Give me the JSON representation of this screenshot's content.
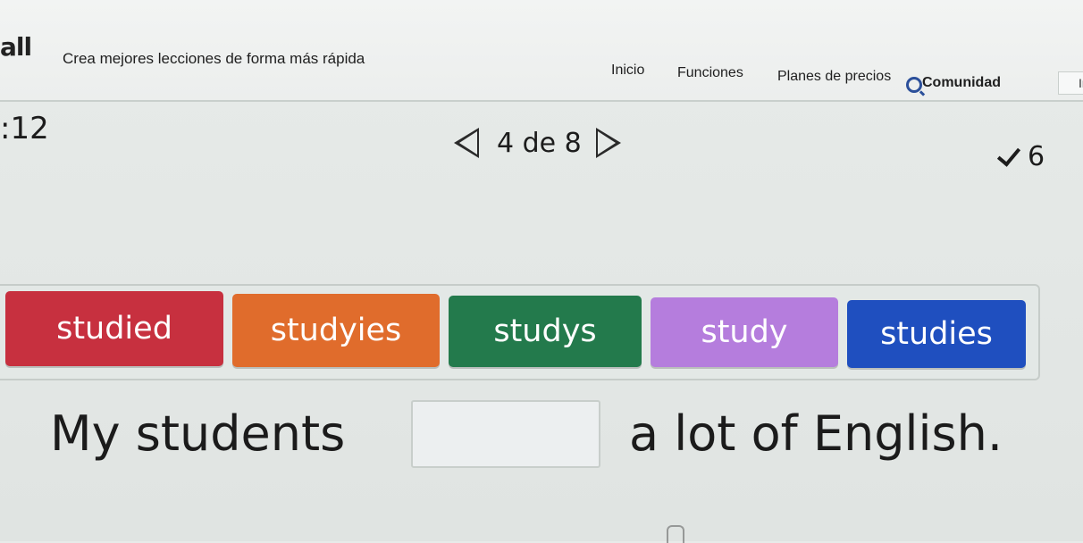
{
  "header": {
    "brand": "all",
    "tagline": "Crea mejores lecciones de forma más rápida",
    "nav": {
      "inicio": "Inicio",
      "funciones": "Funciones",
      "planes": "Planes de precios",
      "comunidad": "Comunidad"
    },
    "edge_label": "Ir",
    "search_icon": "search-icon"
  },
  "status": {
    "timer": ":12",
    "pager": "4 de 8",
    "score": "6",
    "prev_icon": "triangle-left-icon",
    "next_icon": "triangle-right-icon",
    "check_icon": "check-icon"
  },
  "options": [
    {
      "label": "studied",
      "color": "#c7303f"
    },
    {
      "label": "studyies",
      "color": "#e06c2c"
    },
    {
      "label": "studys",
      "color": "#237a4c"
    },
    {
      "label": "study",
      "color": "#b57ddd"
    },
    {
      "label": "studies",
      "color": "#1f4fbf"
    }
  ],
  "sentence": {
    "before": "My students",
    "after": "a lot of English."
  }
}
